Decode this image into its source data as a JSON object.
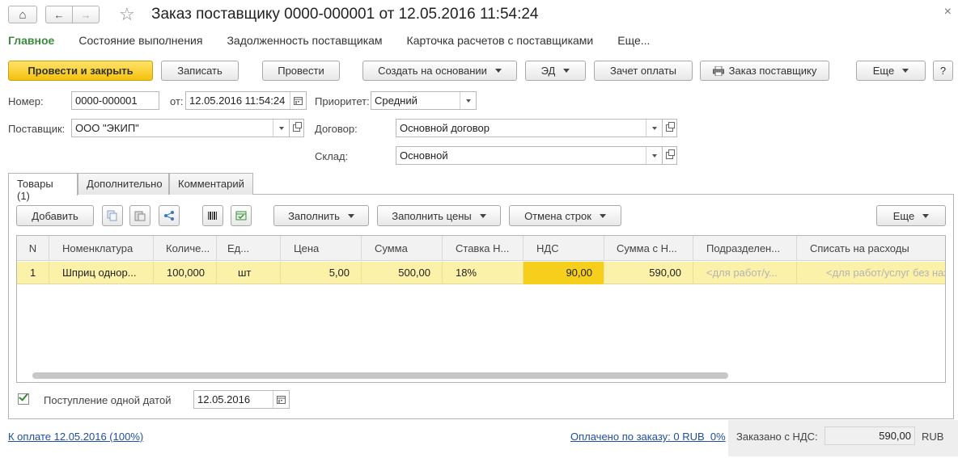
{
  "window": {
    "title": "Заказ поставщику 0000-000001 от 12.05.2016 11:54:24",
    "close_glyph": "×"
  },
  "nav": {
    "home_glyph": "⌂",
    "back_glyph": "←",
    "forward_glyph": "→",
    "star_glyph": "☆"
  },
  "topnav": {
    "items": [
      "Главное",
      "Состояние выполнения",
      "Задолженность поставщикам",
      "Карточка расчетов с поставщиками",
      "Еще..."
    ]
  },
  "toolbar": {
    "post_close": "Провести и закрыть",
    "save": "Записать",
    "post": "Провести",
    "create_based": "Создать на основании",
    "ed": "ЭД",
    "offset": "Зачет оплаты",
    "print_order": "Заказ поставщику",
    "more": "Еще",
    "help": "?"
  },
  "form": {
    "number_label": "Номер:",
    "number_value": "0000-000001",
    "date_label": "от:",
    "date_value": "12.05.2016 11:54:24",
    "priority_label": "Приоритет:",
    "priority_value": "Средний",
    "supplier_label": "Поставщик:",
    "supplier_value": "ООО \"ЭКИП\"",
    "contract_label": "Договор:",
    "contract_value": "Основной договор",
    "warehouse_label": "Склад:",
    "warehouse_value": "Основной"
  },
  "tabs": [
    "Товары (1)",
    "Дополнительно",
    "Комментарий"
  ],
  "table_toolbar": {
    "add": "Добавить",
    "fill": "Заполнить",
    "fill_prices": "Заполнить цены",
    "cancel_rows": "Отмена строк",
    "more": "Еще"
  },
  "table": {
    "headers": [
      "N",
      "Номенклатура",
      "Количе...",
      "Ед...",
      "Цена",
      "Сумма",
      "Ставка Н...",
      "НДС",
      "Сумма с Н...",
      "Подразделен...",
      "Списать на расходы"
    ],
    "rows": [
      {
        "n": "1",
        "item": "Шприц однор...",
        "qty": "100,000",
        "unit": "шт",
        "price": "5,00",
        "sum": "500,00",
        "vat_rate": "18%",
        "vat": "90,00",
        "sum_vat": "590,00",
        "division": "<для работ/у...",
        "expense": "<для работ/услуг без наз"
      }
    ]
  },
  "receipt": {
    "label": "Поступление одной датой",
    "date": "12.05.2016",
    "checked": true
  },
  "footer": {
    "to_pay": "К оплате 12.05.2016 (100%)",
    "paid": "Оплачено по заказу: 0 RUB  0%",
    "ordered_label": "Заказано с НДС:",
    "ordered_value": "590,00",
    "currency": "RUB"
  },
  "colors": {
    "accent_green": "#3c8c3c",
    "primary_yellow": "#f4c20d",
    "row_highlight": "#fbf1a9",
    "cell_highlight": "#f5cf1b",
    "link_blue": "#1e4fa0"
  }
}
